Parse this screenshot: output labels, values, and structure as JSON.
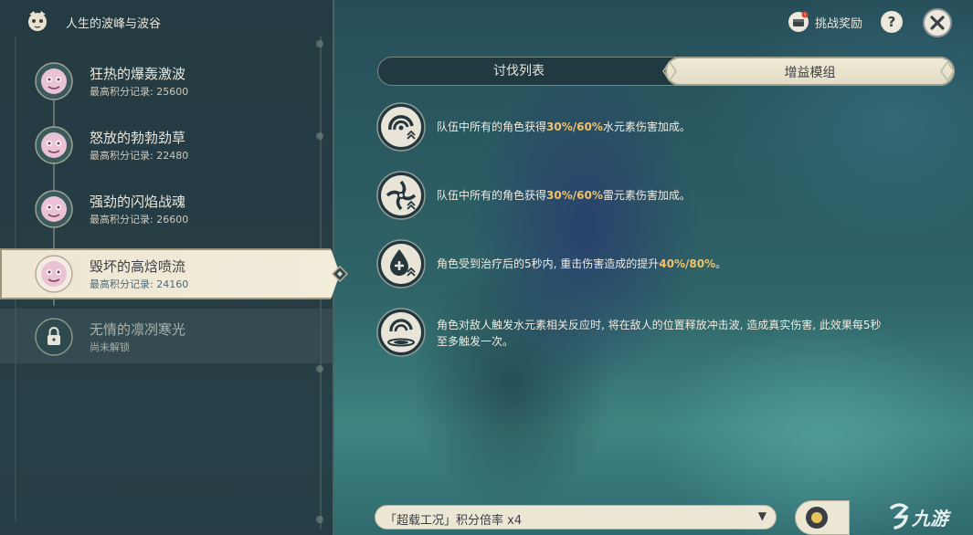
{
  "header": {
    "title": "人生的波峰与波谷"
  },
  "challenges": [
    {
      "name": "狂热的爆轰激波",
      "score": "最高积分记录: 25600",
      "state": "normal"
    },
    {
      "name": "怒放的勃勃劲草",
      "score": "最高积分记录: 22480",
      "state": "normal"
    },
    {
      "name": "强劲的闪焰战魂",
      "score": "最高积分记录: 26600",
      "state": "normal"
    },
    {
      "name": "毁坏的高焓喷流",
      "score": "最高积分记录: 24160",
      "state": "selected"
    },
    {
      "name": "无情的凛冽寒光",
      "score": "尚未解锁",
      "state": "locked"
    }
  ],
  "top_controls": {
    "reward_label": "挑战奖励",
    "help_glyph": "?"
  },
  "tabs": [
    {
      "label": "讨伐列表",
      "active": false
    },
    {
      "label": "增益模组",
      "active": true
    }
  ],
  "buffs": [
    {
      "icon": "hydro-wave-icon",
      "pre": "队伍中所有的角色获得",
      "hl": "30%/60%",
      "post": "水元素伤害加成。"
    },
    {
      "icon": "electro-swirl-icon",
      "pre": "队伍中所有的角色获得",
      "hl": "30%/60%",
      "post": "雷元素伤害加成。"
    },
    {
      "icon": "healing-drop-icon",
      "pre": "角色受到治疗后的5秒内, 重击伤害造成的提升",
      "hl": "40%/80%",
      "post": "。"
    },
    {
      "icon": "shockwave-icon",
      "line1": "角色对敌人触发水元素相关反应时, 将在敌人的位置释放冲击波, 造成真实伤害, 此效果每5秒",
      "line2": "至多触发一次。"
    }
  ],
  "multiplier": {
    "label": "「超载工况」积分倍率 x4",
    "caret": "▼"
  },
  "watermark": {
    "text": "九游"
  },
  "colors": {
    "highlight": "#f2c26a",
    "panel": "#263a42",
    "cream": "#ede6d2"
  }
}
